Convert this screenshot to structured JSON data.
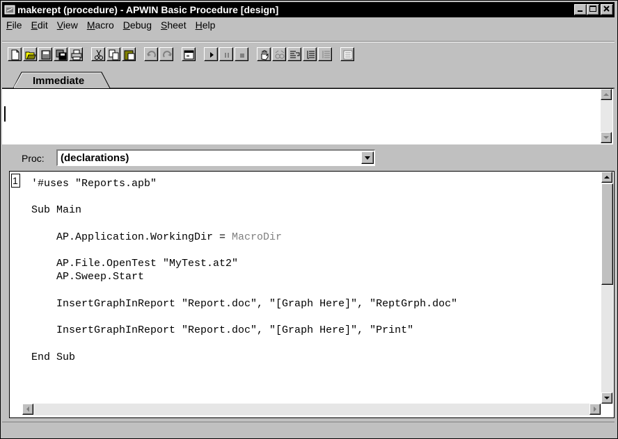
{
  "window": {
    "title": "makerept (procedure) - APWIN Basic Procedure [design]",
    "minimize": "_",
    "maximize": "□",
    "close": "×"
  },
  "menu": [
    {
      "label": "File",
      "u": "F",
      "rest": "ile"
    },
    {
      "label": "Edit",
      "u": "E",
      "rest": "dit"
    },
    {
      "label": "View",
      "u": "V",
      "rest": "iew"
    },
    {
      "label": "Macro",
      "u": "M",
      "rest": "acro"
    },
    {
      "label": "Debug",
      "u": "D",
      "rest": "ebug"
    },
    {
      "label": "Sheet",
      "u": "S",
      "rest": "heet"
    },
    {
      "label": "Help",
      "u": "H",
      "rest": "elp"
    }
  ],
  "toolbar_icons": [
    "new-icon",
    "open-icon",
    "save-icon",
    "save-all-icon",
    "print-icon",
    "cut-icon",
    "copy-icon",
    "paste-icon",
    "undo-icon",
    "redo-icon",
    "dialog-editor-icon",
    "run-icon",
    "pause-icon",
    "stop-icon",
    "hand-icon",
    "watch-icon",
    "step-into-icon",
    "step-over-icon",
    "step-out-icon",
    "properties-icon"
  ],
  "tab": {
    "label": "Immediate"
  },
  "proc": {
    "label": "Proc:",
    "value": "(declarations)"
  },
  "editor": {
    "line_number": "1",
    "lines": [
      "'#uses \"Reports.apb\"",
      "",
      "Sub Main",
      "",
      "    AP.Application.WorkingDir = ",
      "",
      "    AP.File.OpenTest \"MyTest.at2\"",
      "    AP.Sweep.Start",
      "",
      "    InsertGraphInReport \"Report.doc\", \"[Graph Here]\", \"ReptGrph.doc\"",
      "",
      "    InsertGraphInReport \"Report.doc\", \"[Graph Here]\", \"Print\"",
      "",
      "End Sub"
    ],
    "macrodir": "MacroDir"
  },
  "colors": {
    "titlebar": "#000000",
    "face": "#c0c0c0",
    "comment_gray": "#808080"
  }
}
